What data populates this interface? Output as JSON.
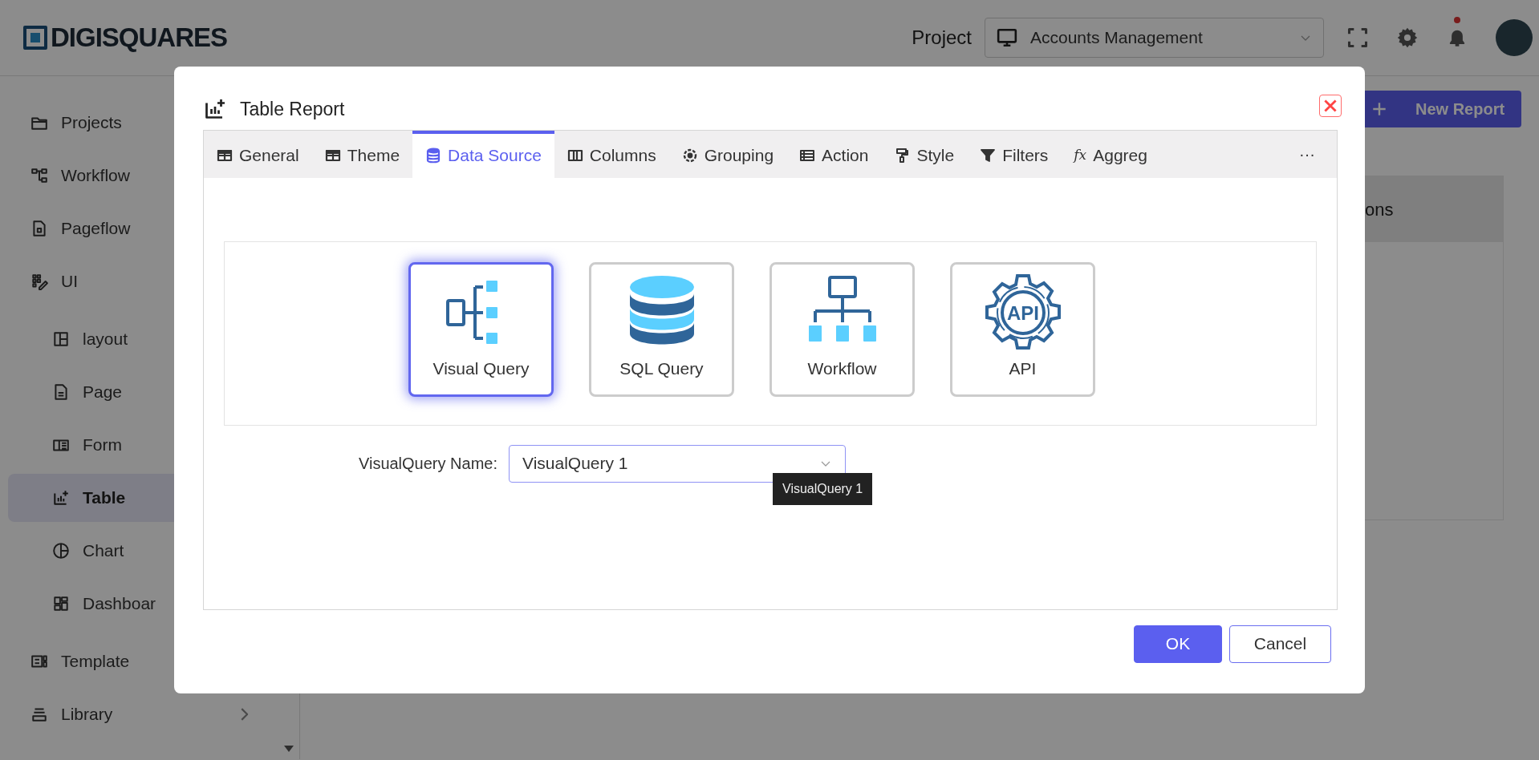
{
  "header": {
    "logo": "DIGISQUARES",
    "project_label": "Project",
    "project_value": "Accounts Management",
    "notification_dot": true
  },
  "sidebar": {
    "items": [
      {
        "label": "Projects",
        "selected": false
      },
      {
        "label": "Workflow",
        "selected": false
      },
      {
        "label": "Pageflow",
        "selected": false
      },
      {
        "label": "UI",
        "selected": false,
        "expanded": true,
        "children": [
          {
            "label": "layout",
            "selected": false
          },
          {
            "label": "Page",
            "selected": false
          },
          {
            "label": "Form",
            "selected": false
          },
          {
            "label": "Table",
            "selected": true
          },
          {
            "label": "Chart",
            "selected": false
          },
          {
            "label": "Dashboar",
            "selected": false
          }
        ]
      },
      {
        "label": "Template",
        "selected": false
      },
      {
        "label": "Library",
        "selected": false,
        "expanded": false
      }
    ]
  },
  "main": {
    "new_report_button": "New Report",
    "card_heading": "ons"
  },
  "dialog": {
    "title": "Table Report",
    "tabs": [
      {
        "label": "General",
        "selected": false
      },
      {
        "label": "Theme",
        "selected": false
      },
      {
        "label": "Data Source",
        "selected": true
      },
      {
        "label": "Columns",
        "selected": false
      },
      {
        "label": "Grouping",
        "selected": false
      },
      {
        "label": "Action",
        "selected": false
      },
      {
        "label": "Style",
        "selected": false
      },
      {
        "label": "Filters",
        "selected": false
      },
      {
        "label": "Aggreg",
        "selected": false,
        "icon_text": "fx"
      }
    ],
    "more_tabs": "···",
    "sources": [
      {
        "label": "Visual Query",
        "selected": true
      },
      {
        "label": "SQL Query",
        "selected": false
      },
      {
        "label": "Workflow",
        "selected": false
      },
      {
        "label": "API",
        "selected": false,
        "icon_text": "API"
      }
    ],
    "field": {
      "label": "VisualQuery Name:",
      "value": "VisualQuery 1",
      "tooltip": "VisualQuery 1"
    },
    "buttons": [
      {
        "label": "OK",
        "kind": "primary"
      },
      {
        "label": "Cancel",
        "kind": "secondary"
      }
    ]
  }
}
